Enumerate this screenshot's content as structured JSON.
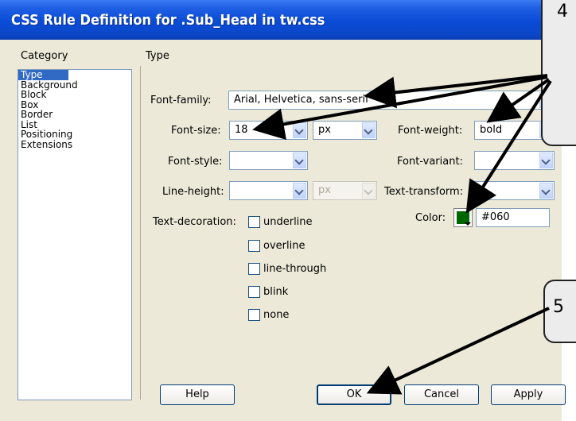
{
  "window": {
    "title": "CSS Rule Definition for .Sub_Head in tw.css"
  },
  "category": {
    "label": "Category",
    "items": [
      "Type",
      "Background",
      "Block",
      "Box",
      "Border",
      "List",
      "Positioning",
      "Extensions"
    ],
    "selected": "Type"
  },
  "panel": {
    "title": "Type"
  },
  "fields": {
    "font_family": {
      "label": "Font-family:",
      "value": "Arial, Helvetica, sans-serif"
    },
    "font_size": {
      "label": "Font-size:",
      "value": "18",
      "unit": "px"
    },
    "font_weight": {
      "label": "Font-weight:",
      "value": "bold"
    },
    "font_style": {
      "label": "Font-style:",
      "value": ""
    },
    "font_variant": {
      "label": "Font-variant:",
      "value": ""
    },
    "line_height": {
      "label": "Line-height:",
      "value": "",
      "unit": "px"
    },
    "text_transform": {
      "label": "Text-transform:",
      "value": ""
    },
    "color": {
      "label": "Color:",
      "value": "#060",
      "swatch": "#006600"
    },
    "text_decoration": {
      "label": "Text-decoration:",
      "options": [
        "underline",
        "overline",
        "line-through",
        "blink",
        "none"
      ]
    }
  },
  "buttons": {
    "help": "Help",
    "ok": "OK",
    "cancel": "Cancel",
    "apply": "Apply"
  },
  "callouts": {
    "step4": "4",
    "step5": "5"
  },
  "colors": {
    "title_bar": "#0a4bd6",
    "dialog_bg": "#ece9d8",
    "selection": "#316ac5"
  }
}
